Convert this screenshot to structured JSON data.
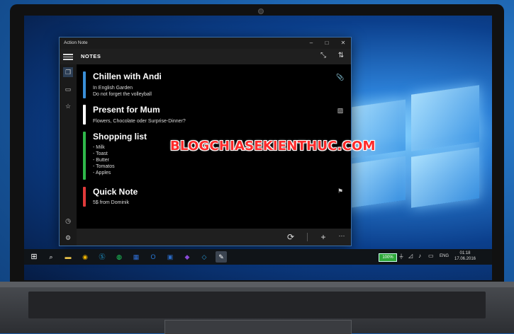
{
  "window": {
    "title": "Action Note",
    "minimize": "–",
    "maximize": "□",
    "close": "✕"
  },
  "header": {
    "title": "NOTES"
  },
  "notes": [
    {
      "title": "Chillen with Andi",
      "lines": [
        "In English Garden",
        "Do not forget the volleyball"
      ],
      "color": "#3a8fd8",
      "icon": "paperclip-icon"
    },
    {
      "title": "Present for Mum",
      "lines": [
        "Flowers, Chocolate oder Surprise-Dinner?"
      ],
      "color": "#ffffff",
      "icon": "image-icon"
    },
    {
      "title": "Shopping list",
      "lines": [
        "- Milk",
        "- Toast",
        "- Butter",
        "- Tomatos",
        "- Apples"
      ],
      "color": "#2fb84a",
      "icon": ""
    },
    {
      "title": "Quick Note",
      "lines": [
        "5$ from Dominik"
      ],
      "color": "#e03a3a",
      "icon": "flag-icon"
    }
  ],
  "watermark": "BLOGCHIASEKIENTHUC.COM",
  "taskbar": {
    "battery": "100%",
    "language": "ENG",
    "time": "01:18",
    "date": "17.06.2016"
  },
  "colors": {
    "accent": "#3a6ea8",
    "app_bg": "#000000"
  }
}
